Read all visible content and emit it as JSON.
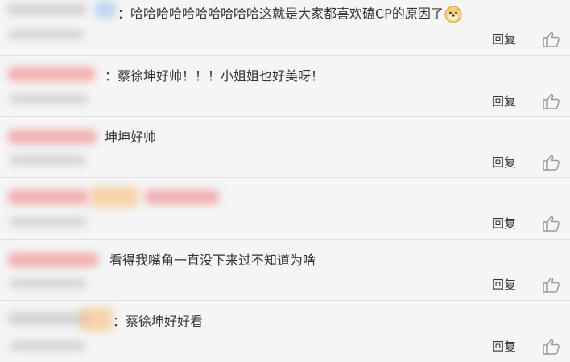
{
  "comments": [
    {
      "text": "：哈哈哈哈哈哈哈哈哈哈这就是大家都喜欢磕CP的原因了",
      "reply": "回复",
      "emoji": "doge-emoji"
    },
    {
      "text": "：蔡徐坤好帅！！！小姐姐也好美呀！",
      "reply": "回复"
    },
    {
      "text": "坤坤好帅",
      "reply": "回复"
    },
    {
      "text": "",
      "reply": "回复"
    },
    {
      "text": "看得我嘴角一直没下来过不知道为啥",
      "reply": "回复"
    },
    {
      "text": "：蔡徐坤好好看",
      "reply": "回复"
    }
  ],
  "icons": {
    "like": "thumbs-up-icon",
    "emoji": "doge-emoji"
  },
  "colors": {
    "background": "#f5f5f5",
    "text": "#333333",
    "divider": "#e2e2e2",
    "icon": "#999999"
  }
}
